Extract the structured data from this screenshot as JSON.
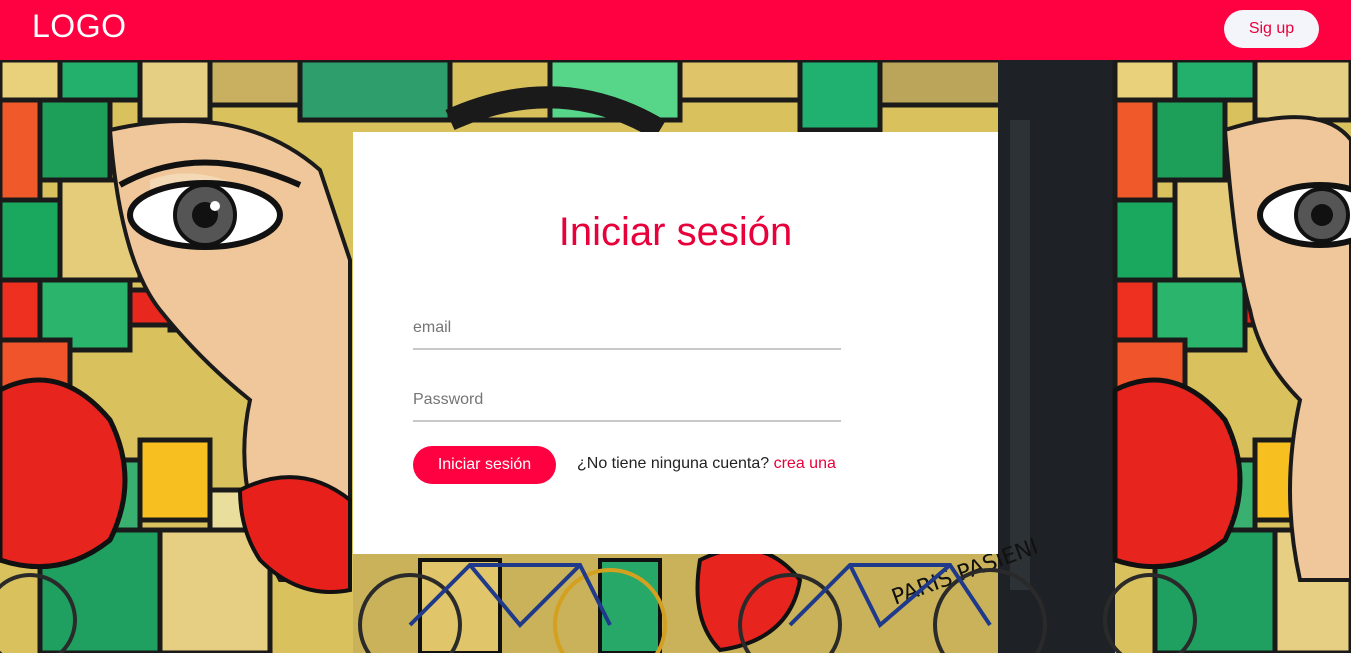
{
  "navbar": {
    "logo": "LOGO",
    "signup_label": "Sig up"
  },
  "login": {
    "title": "Iniciar sesión",
    "email_placeholder": "email",
    "password_placeholder": "Password",
    "submit_label": "Iniciar sesión",
    "no_account_text": "¿No tiene ninguna cuenta?",
    "create_link": "crea una"
  },
  "background": {
    "graffiti_text": "PARIS PASIENI"
  },
  "colors": {
    "brand": "#ff0040",
    "accent_text": "#e8003a",
    "signup_bg": "#f4f5fa",
    "card_bg": "#ffffff"
  }
}
